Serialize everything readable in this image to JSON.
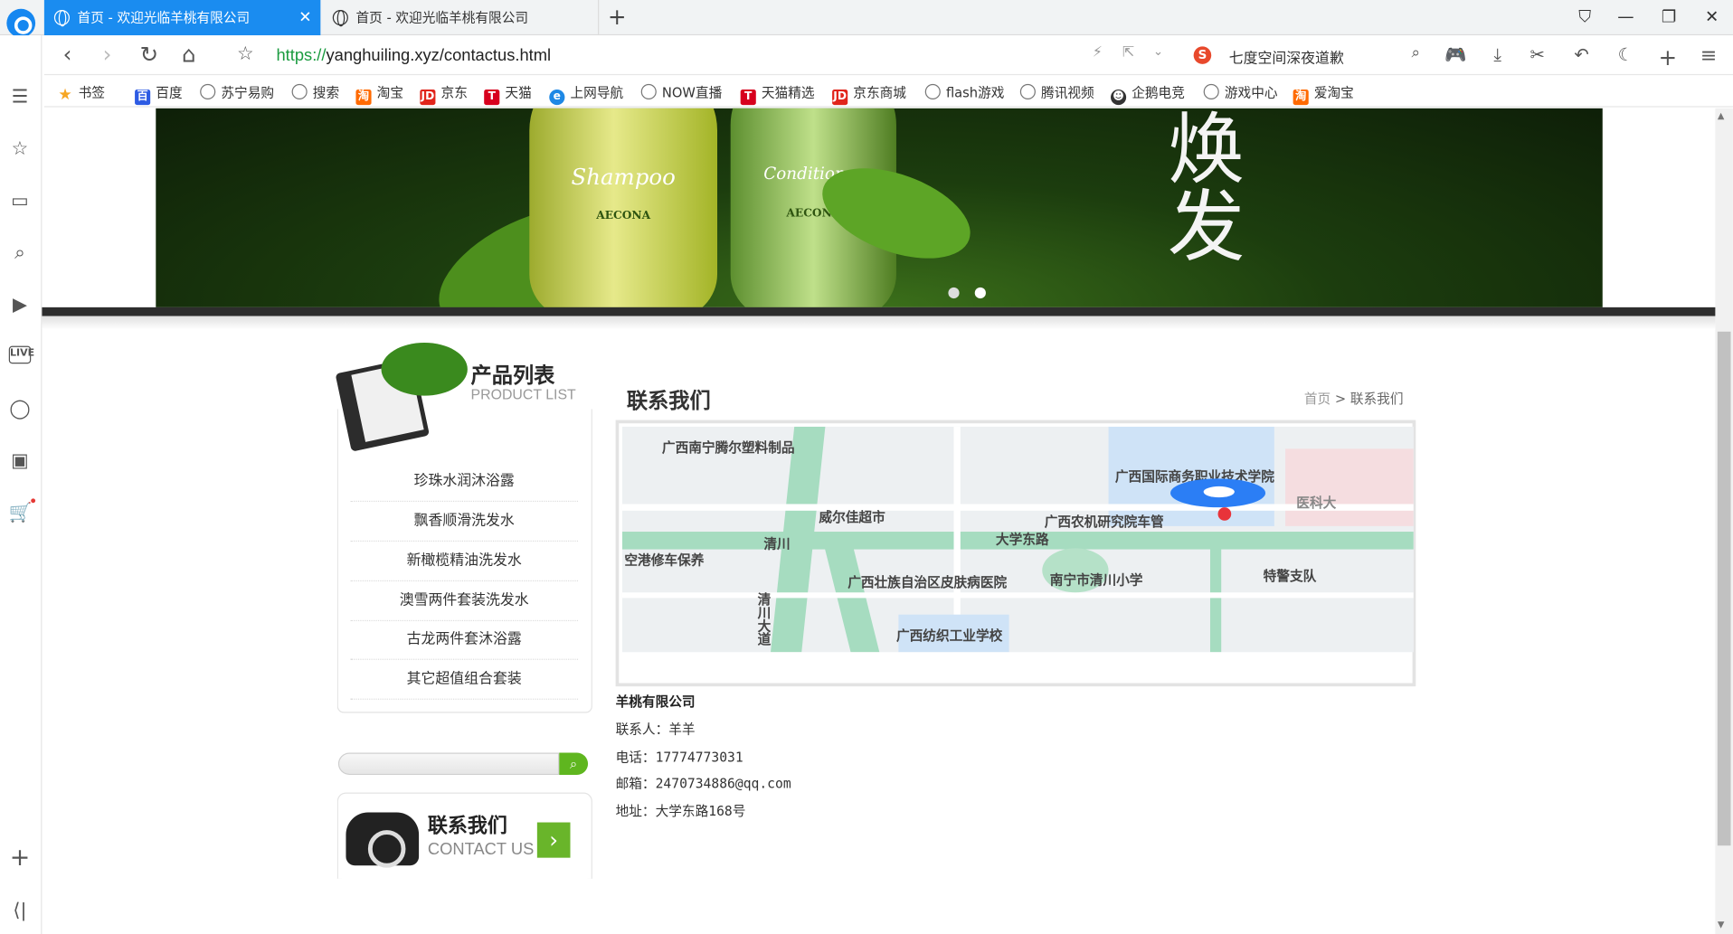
{
  "browser": {
    "tabs": [
      {
        "title": "首页 - 欢迎光临羊桃有限公司",
        "active": true
      },
      {
        "title": "首页 - 欢迎光临羊桃有限公司",
        "active": false
      }
    ],
    "url_protocol": "https://",
    "url_rest": "yanghuiling.xyz/contactus.html",
    "search_suggestion": "七度空间深夜道歉",
    "bookmarks": [
      "书签",
      "百度",
      "苏宁易购",
      "搜索",
      "淘宝",
      "京东",
      "天猫",
      "上网导航",
      "NOW直播",
      "天猫精选",
      "京东商城",
      "flash游戏",
      "腾讯视频",
      "企鹅电竞",
      "游戏中心",
      "爱淘宝"
    ]
  },
  "banner": {
    "bottle1_label": "Shampoo",
    "bottle1_brand": "AECONA",
    "bottle2_label": "Conditioner",
    "bottle2_brand": "AECONA",
    "slogan": "焕发"
  },
  "sidebar_products": {
    "title": "产品列表",
    "subtitle": "PRODUCT LIST",
    "items": [
      "珍珠水润沐浴露",
      "飘香顺滑洗发水",
      "新橄榄精油洗发水",
      "澳雪两件套装洗发水",
      "古龙两件套沐浴露",
      "其它超值组合套装"
    ]
  },
  "contact_box": {
    "title": "联系我们",
    "subtitle": "CONTACT US"
  },
  "main": {
    "title": "联系我们",
    "breadcrumb_home": "首页",
    "breadcrumb_sep": ">",
    "breadcrumb_current": "联系我们",
    "map_labels": [
      "广西南宁腾尔塑料制品",
      "广西国际商务职业技术学院",
      "威尔佳超市",
      "广西农机研究院车管",
      "大学东路",
      "清川",
      "南宁市清川小学",
      "广西壮族自治区皮肤病医院",
      "清川大道",
      "广西纺织工业学校",
      "空港修车保养",
      "特警支队",
      "医科大"
    ],
    "company": "羊桃有限公司",
    "contact_person": "联系人：羊羊",
    "phone": "电话：17774773031",
    "email": "邮箱：2470734886@qq.com",
    "address": "地址：大学东路168号"
  }
}
